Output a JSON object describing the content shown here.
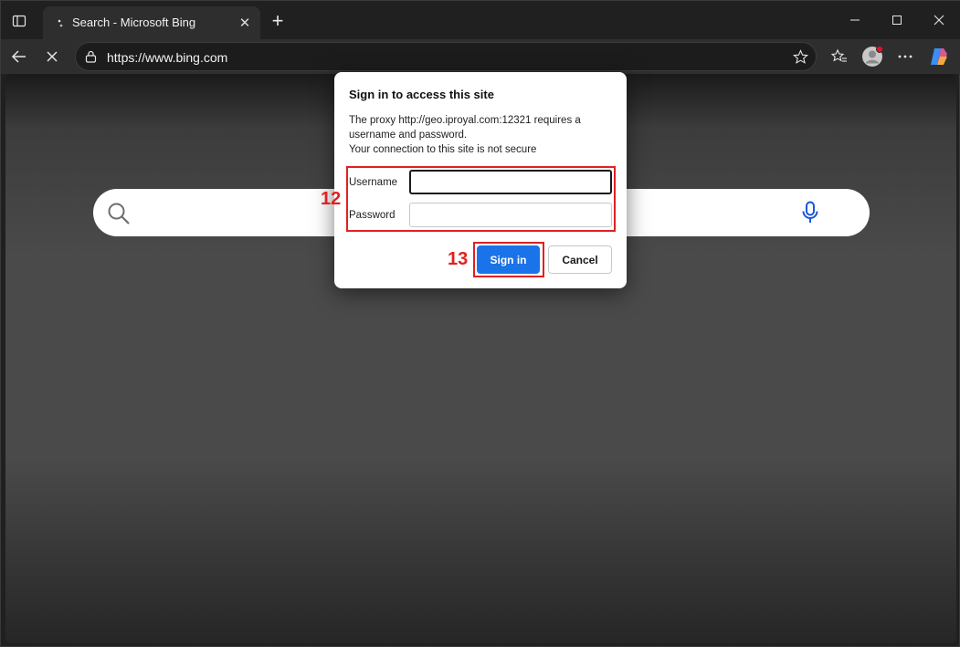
{
  "browser": {
    "tab": {
      "title": "Search - Microsoft Bing",
      "close_glyph": "✕"
    },
    "new_tab_glyph": "+",
    "window_controls": {
      "minimize": "—",
      "maximize": "☐",
      "close": "✕"
    },
    "address": {
      "url": "https://www.bing.com"
    },
    "icons": [
      "sidebar-toggle-icon",
      "back-arrow-icon",
      "stop-loading-icon",
      "lock-icon",
      "favorite-star-icon",
      "favorites-icon",
      "profile-icon",
      "more-icon",
      "copilot-icon"
    ]
  },
  "page": {
    "search_icon": "search-icon",
    "mic_icon": "microphone-icon"
  },
  "dialog": {
    "title": "Sign in to access this site",
    "message_line1": "The proxy http://geo.iproyal.com:12321 requires a username and password.",
    "message_line2": "Your connection to this site is not secure",
    "username_label": "Username",
    "username_value": "",
    "password_label": "Password",
    "password_value": "",
    "sign_in_label": "Sign in",
    "cancel_label": "Cancel"
  },
  "annotations": {
    "step_12": "12",
    "step_13": "13",
    "color": "#e02020"
  },
  "colors": {
    "primary_button": "#1a73e8",
    "profile_badge": "#e81123"
  }
}
